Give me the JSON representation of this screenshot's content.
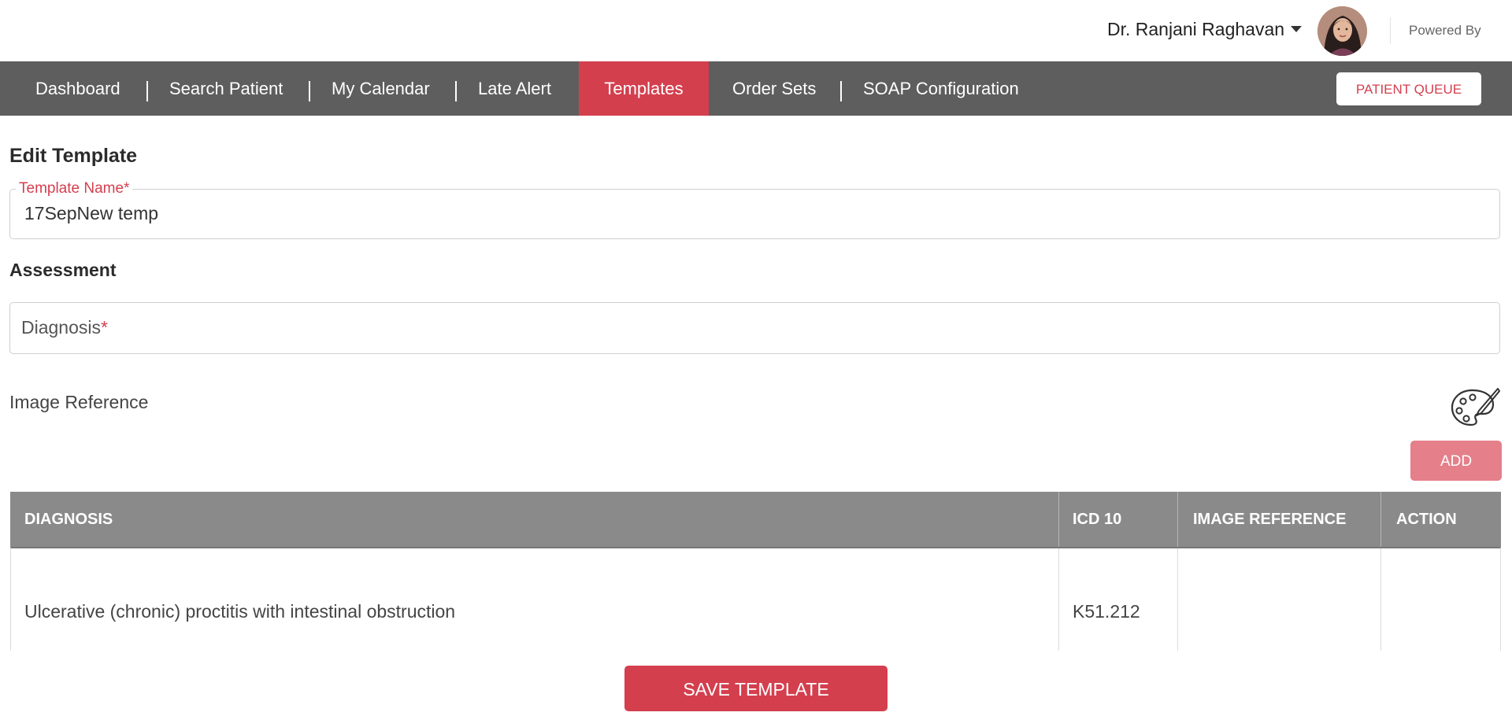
{
  "header": {
    "user_name": "Dr. Ranjani Raghavan",
    "powered_by": "Powered By"
  },
  "nav": {
    "items": [
      {
        "label": "Dashboard"
      },
      {
        "label": "Search Patient"
      },
      {
        "label": "My Calendar"
      },
      {
        "label": "Late Alert"
      },
      {
        "label": "Templates",
        "active": true
      },
      {
        "label": "Order Sets"
      },
      {
        "label": "SOAP Configuration"
      }
    ],
    "patient_queue_label": "PATIENT QUEUE"
  },
  "form": {
    "page_title": "Edit Template",
    "template_name_label": "Template Name*",
    "template_name_value": "17SepNew temp",
    "assessment_title": "Assessment",
    "diagnosis_placeholder": "Diagnosis",
    "diagnosis_required_mark": "*",
    "image_reference_label": "Image Reference",
    "add_label": "ADD"
  },
  "table": {
    "columns": [
      "DIAGNOSIS",
      "ICD 10",
      "IMAGE REFERENCE",
      "ACTION"
    ],
    "rows": [
      {
        "diagnosis": "Ulcerative (chronic) proctitis with intestinal obstruction",
        "icd10": "K51.212",
        "image_reference": "",
        "action": ""
      }
    ]
  },
  "footer": {
    "save_label": "SAVE TEMPLATE"
  },
  "colors": {
    "accent": "#d43f4e",
    "nav_bg": "#5e5e5e",
    "table_header_bg": "#8a8a8a",
    "add_button_bg": "#e57f8a"
  },
  "icons": {
    "palette": "palette-icon",
    "caret": "caret-down-icon",
    "avatar": "user-avatar"
  }
}
